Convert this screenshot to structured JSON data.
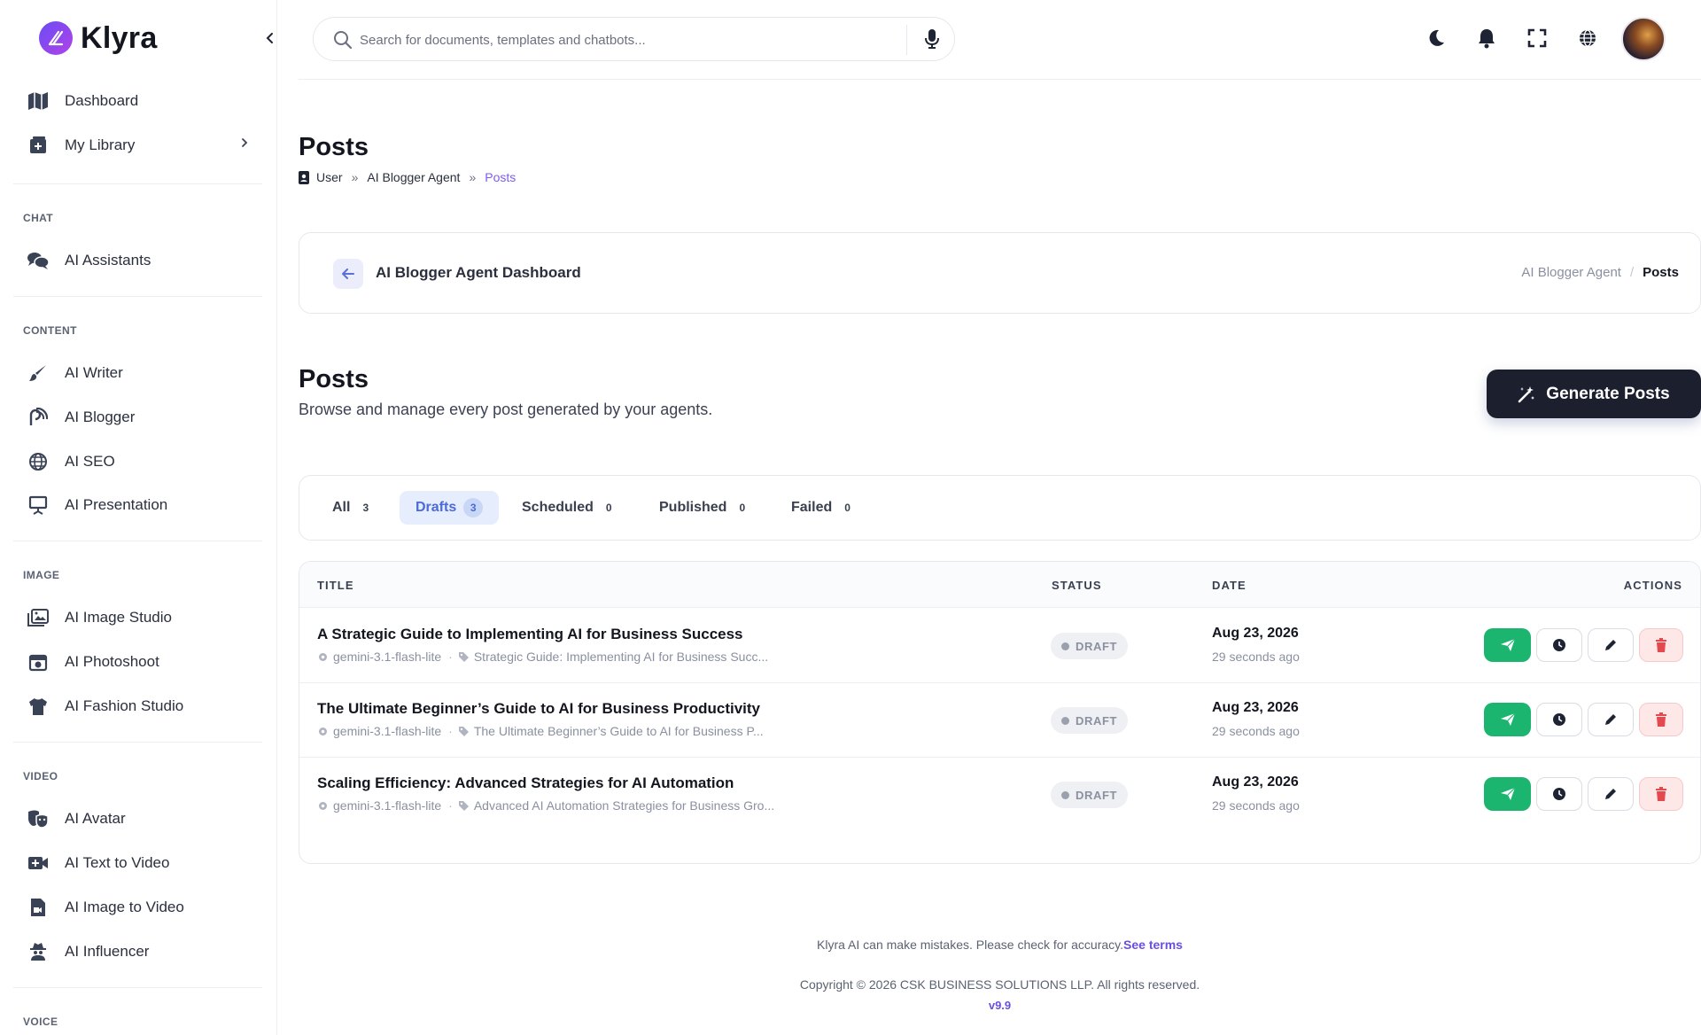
{
  "brand": {
    "name": "Klyra"
  },
  "sidebar": {
    "items_top": [
      {
        "label": "Dashboard",
        "icon": "map-icon"
      },
      {
        "label": "My Library",
        "icon": "library-add-icon"
      }
    ],
    "sections": [
      {
        "label": "CHAT",
        "items": [
          {
            "label": "AI Assistants",
            "icon": "chat-bubbles-icon"
          }
        ]
      },
      {
        "label": "CONTENT",
        "items": [
          {
            "label": "AI Writer",
            "icon": "brush-icon"
          },
          {
            "label": "AI Blogger",
            "icon": "blog-icon"
          },
          {
            "label": "AI SEO",
            "icon": "globe-icon"
          },
          {
            "label": "AI Presentation",
            "icon": "presentation-icon"
          }
        ]
      },
      {
        "label": "IMAGE",
        "items": [
          {
            "label": "AI Image Studio",
            "icon": "images-icon"
          },
          {
            "label": "AI Photoshoot",
            "icon": "camera-icon"
          },
          {
            "label": "AI Fashion Studio",
            "icon": "shirt-icon"
          }
        ]
      },
      {
        "label": "VIDEO",
        "items": [
          {
            "label": "AI Avatar",
            "icon": "masks-icon"
          },
          {
            "label": "AI Text to Video",
            "icon": "video-plus-icon"
          },
          {
            "label": "AI Image to Video",
            "icon": "file-video-icon"
          },
          {
            "label": "AI Influencer",
            "icon": "user-secret-icon"
          }
        ]
      },
      {
        "label": "VOICE",
        "items": []
      }
    ]
  },
  "search": {
    "placeholder": "Search for documents, templates and chatbots..."
  },
  "page": {
    "title": "Posts",
    "breadcrumb": [
      "User",
      "AI Blogger Agent",
      "Posts"
    ]
  },
  "agent_card": {
    "title": "AI Blogger Agent Dashboard",
    "crumb_parent": "AI Blogger Agent",
    "crumb_current": "Posts"
  },
  "posts": {
    "heading": "Posts",
    "subtitle": "Browse and manage every post generated by your agents.",
    "generate_label": "Generate Posts"
  },
  "tabs": [
    {
      "label": "All",
      "count": "3"
    },
    {
      "label": "Drafts",
      "count": "3",
      "active": true
    },
    {
      "label": "Scheduled",
      "count": "0"
    },
    {
      "label": "Published",
      "count": "0"
    },
    {
      "label": "Failed",
      "count": "0"
    }
  ],
  "table": {
    "columns": [
      "TITLE",
      "STATUS",
      "DATE",
      "ACTIONS"
    ],
    "rows": [
      {
        "title": "A Strategic Guide to Implementing AI for Business Success",
        "model": "gemini-3.1-flash-lite",
        "tag": "Strategic Guide: Implementing AI for Business Succ...",
        "status": "DRAFT",
        "date": "Aug 23, 2026",
        "ago": "29 seconds ago"
      },
      {
        "title": "The Ultimate Beginner’s Guide to AI for Business Productivity",
        "model": "gemini-3.1-flash-lite",
        "tag": "The Ultimate Beginner’s Guide to AI for Business P...",
        "status": "DRAFT",
        "date": "Aug 23, 2026",
        "ago": "29 seconds ago"
      },
      {
        "title": "Scaling Efficiency: Advanced Strategies for AI Automation",
        "model": "gemini-3.1-flash-lite",
        "tag": "Advanced AI Automation Strategies for Business Gro...",
        "status": "DRAFT",
        "date": "Aug 23, 2026",
        "ago": "29 seconds ago"
      }
    ]
  },
  "footer": {
    "disclaimer": "Klyra AI can make mistakes. Please check for accuracy.",
    "terms_link": "See terms",
    "copyright": "Copyright © 2026 CSK BUSINESS SOLUTIONS LLP. All rights reserved.",
    "version": "v9.9"
  },
  "colors": {
    "accent": "#7c5cf0",
    "primary_dark": "#1c1f2e",
    "success": "#1cb56f",
    "danger": "#e5484d",
    "tab_active_bg": "#e6edfc"
  }
}
